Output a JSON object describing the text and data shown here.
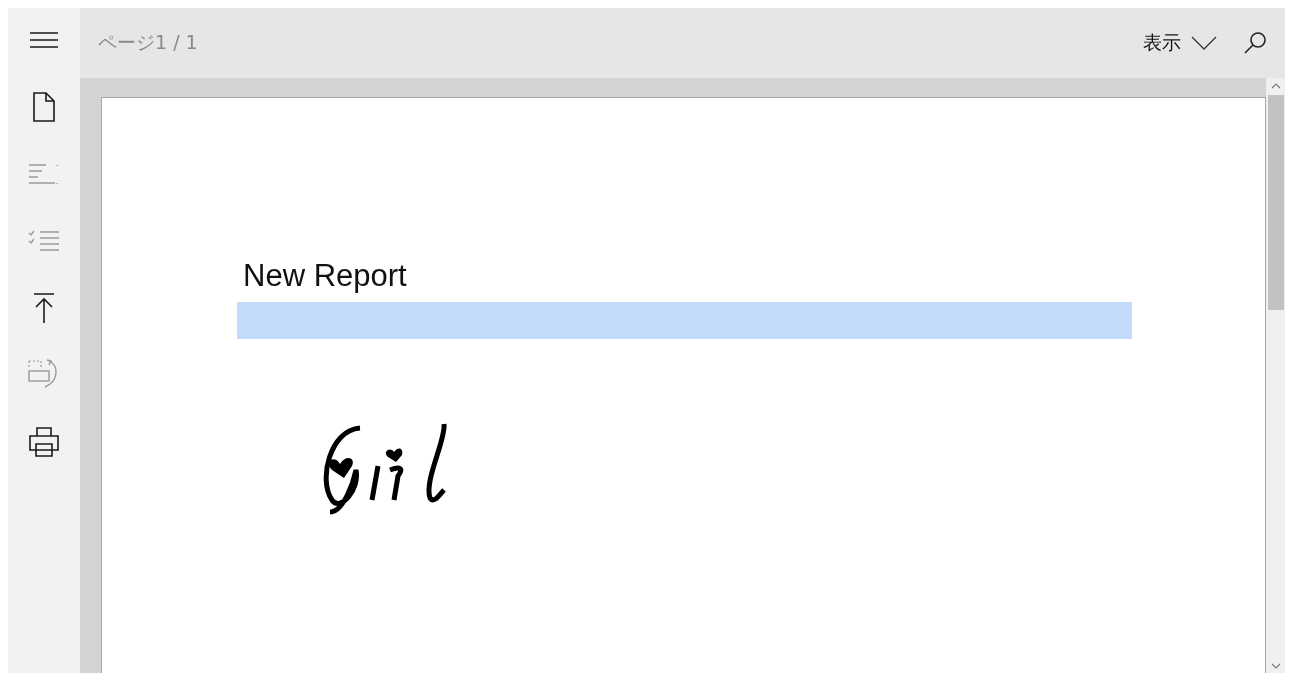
{
  "sidebar": {
    "items": [
      {
        "kind": "menu",
        "disabled": false
      },
      {
        "kind": "document",
        "disabled": false
      },
      {
        "kind": "outline",
        "disabled": true
      },
      {
        "kind": "checklist",
        "disabled": true
      },
      {
        "kind": "top",
        "disabled": false
      },
      {
        "kind": "rotate",
        "disabled": true
      },
      {
        "kind": "print",
        "disabled": false
      }
    ]
  },
  "toolbar": {
    "page_indicator": "ページ1 / 1",
    "view_menu": "表示"
  },
  "report": {
    "title": "New Report"
  }
}
